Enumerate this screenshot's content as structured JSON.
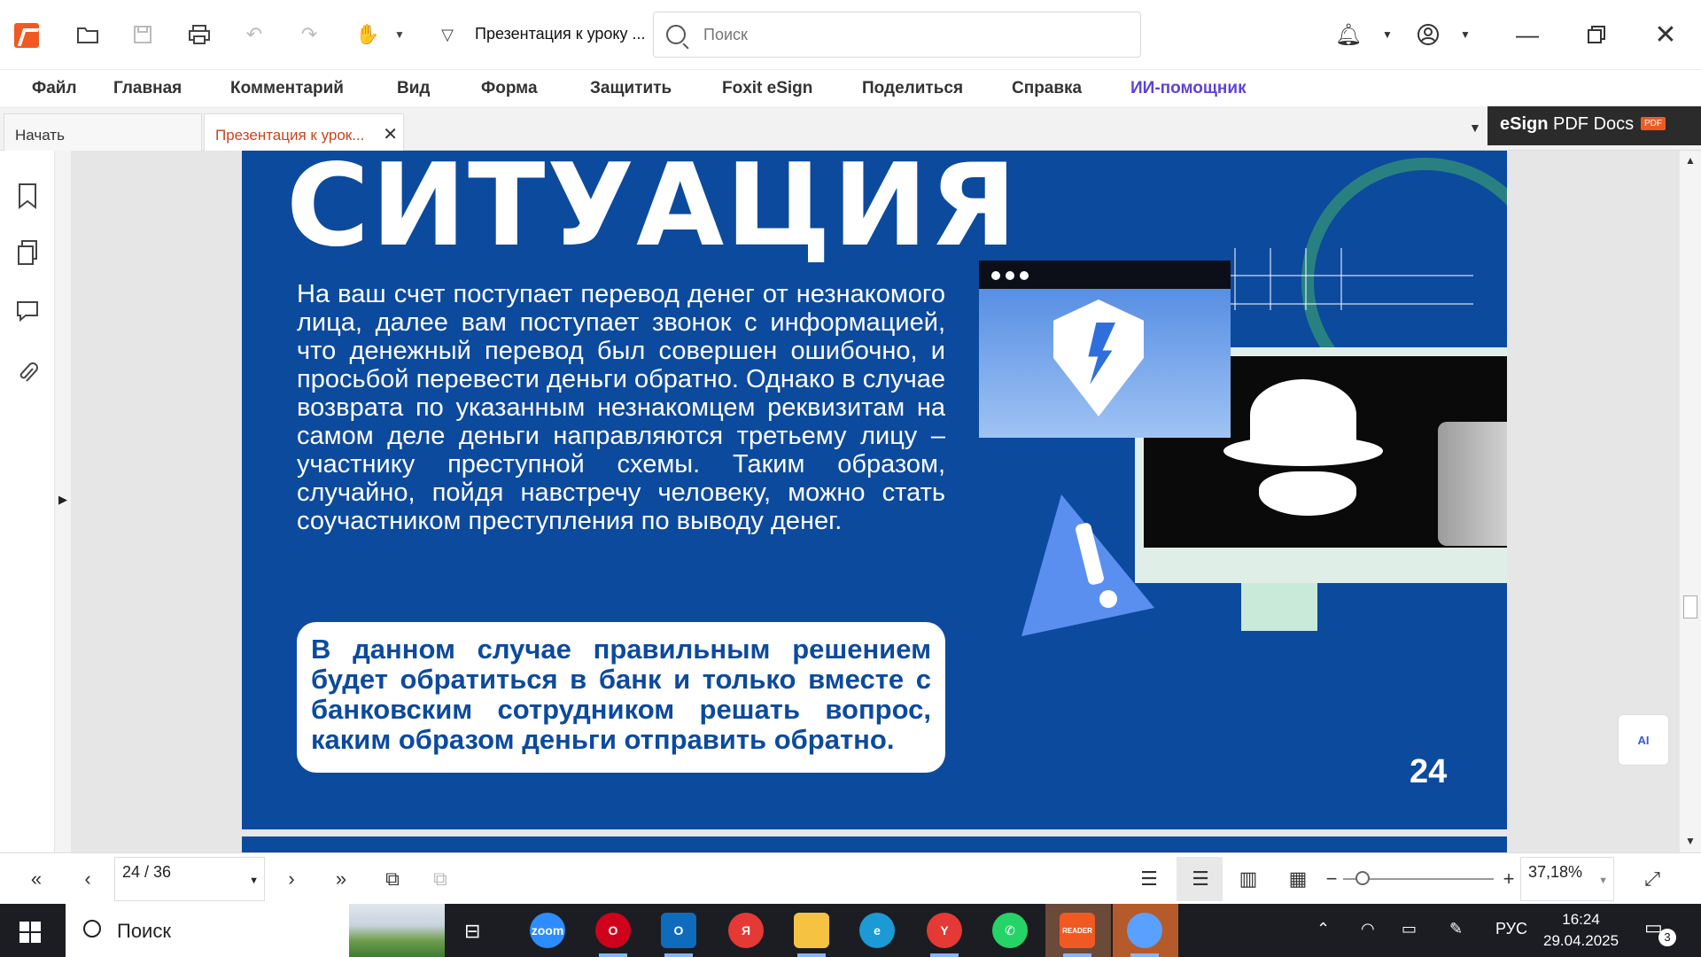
{
  "titlebar": {
    "doc_title": "Презентация к уроку ...",
    "search_placeholder": "Поиск"
  },
  "menu": {
    "items": [
      "Файл",
      "Главная",
      "Комментарий",
      "Вид",
      "Форма",
      "Защитить",
      "Foxit eSign",
      "Поделиться",
      "Справка",
      "ИИ-помощник"
    ]
  },
  "tabs": [
    {
      "label": "Начать",
      "active": false
    },
    {
      "label": "Презентация к урок...",
      "active": true
    }
  ],
  "esign": {
    "brand": "eSign",
    "text": "PDF Docs",
    "badge": "PDF"
  },
  "slide": {
    "heading": "СИТУАЦИЯ",
    "body": "На ваш счет поступает перевод денег от незнакомого лица, далее вам поступает звонок с информацией, что денежный перевод был совершен ошибочно, и просьбой перевести деньги обратно. Однако в случае возврата по указанным незнакомцем реквизитам на самом деле деньги направляются третьему лицу – участнику преступной схемы. Таким образом, случайно, пойдя навстречу человеку, можно стать соучастником преступления по выводу денег.",
    "callout": "В данном случае правильным решением будет обратиться в банк и только вместе с банковским сотрудником решать вопрос, каким образом деньги отправить обратно.",
    "page_number": "24"
  },
  "status": {
    "page_display": "24 / 36",
    "zoom": "37,18%",
    "zoom_fraction": 0.13
  },
  "ai_bubble": "AI",
  "taskbar": {
    "search_label": "Поиск",
    "apps": [
      {
        "name": "zoom",
        "label": "zoom",
        "color": "#2d8cff"
      },
      {
        "name": "opera",
        "label": "O",
        "color": "#d0021b"
      },
      {
        "name": "outlook",
        "label": "O",
        "color": "#0f6cbd"
      },
      {
        "name": "yandex",
        "label": "Я",
        "color": "#e53935"
      },
      {
        "name": "explorer",
        "label": "",
        "color": "#f5c242"
      },
      {
        "name": "edge",
        "label": "e",
        "color": "#1c9ad6"
      },
      {
        "name": "yandex-browser",
        "label": "Y",
        "color": "#e53935"
      },
      {
        "name": "whatsapp",
        "label": "✆",
        "color": "#25d366"
      },
      {
        "name": "foxit-reader",
        "label": "READER",
        "color": "#f05a22"
      },
      {
        "name": "app-wave",
        "label": "",
        "color": "#5aa0ff"
      }
    ],
    "language": "РУС",
    "time": "16:24",
    "date": "29.04.2025",
    "notifications": "3"
  }
}
